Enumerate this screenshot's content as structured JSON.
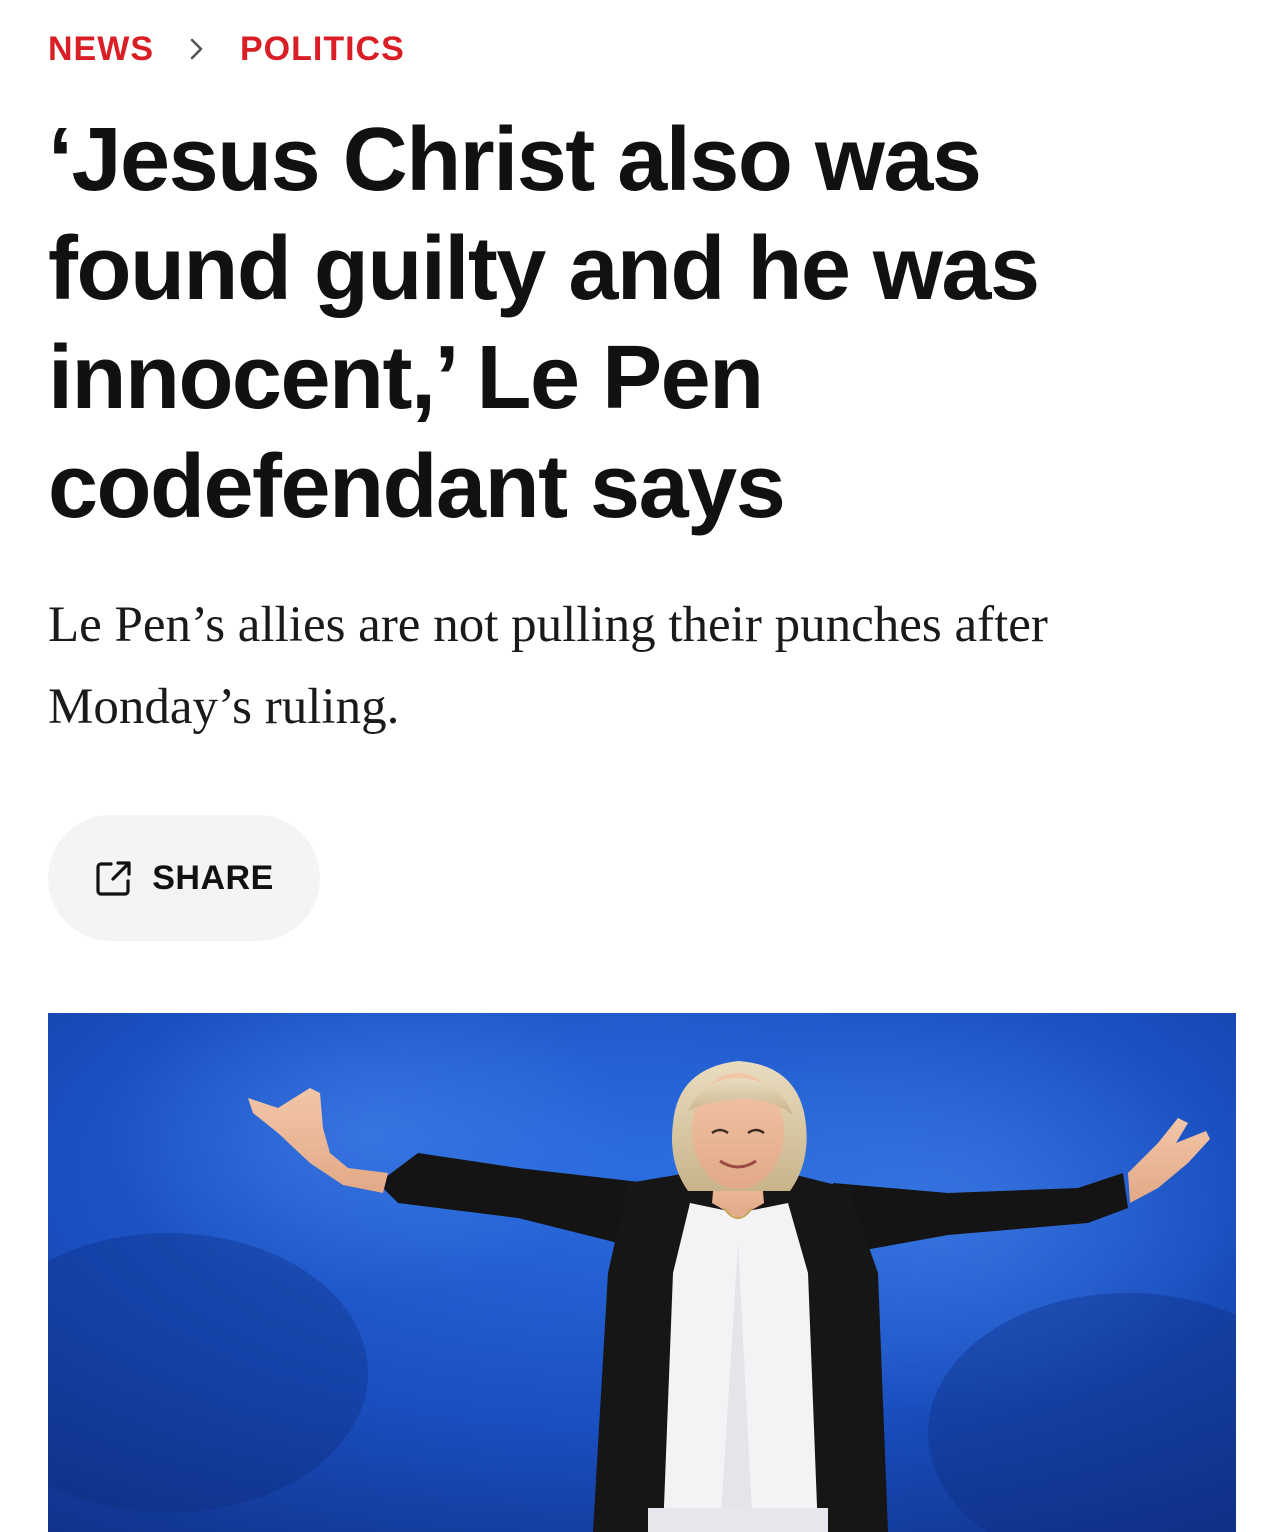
{
  "breadcrumb": {
    "section": "NEWS",
    "subsection": "POLITICS",
    "separator_icon": "chevron-right-icon"
  },
  "article": {
    "headline": "‘Jesus Christ also was found guilty and he was innocent,’ Le Pen codefendant says",
    "dek": "Le Pen’s allies are not pulling their punches after Monday’s ruling."
  },
  "share": {
    "label": "SHARE",
    "icon": "share-external-icon"
  },
  "hero_image": {
    "alt": "Woman with arms outstretched on stage against a blue backdrop"
  },
  "colors": {
    "accent": "#d91e26",
    "text": "#111111",
    "button_bg": "#f4f4f4",
    "hero_backdrop": "#1a4fc0"
  }
}
